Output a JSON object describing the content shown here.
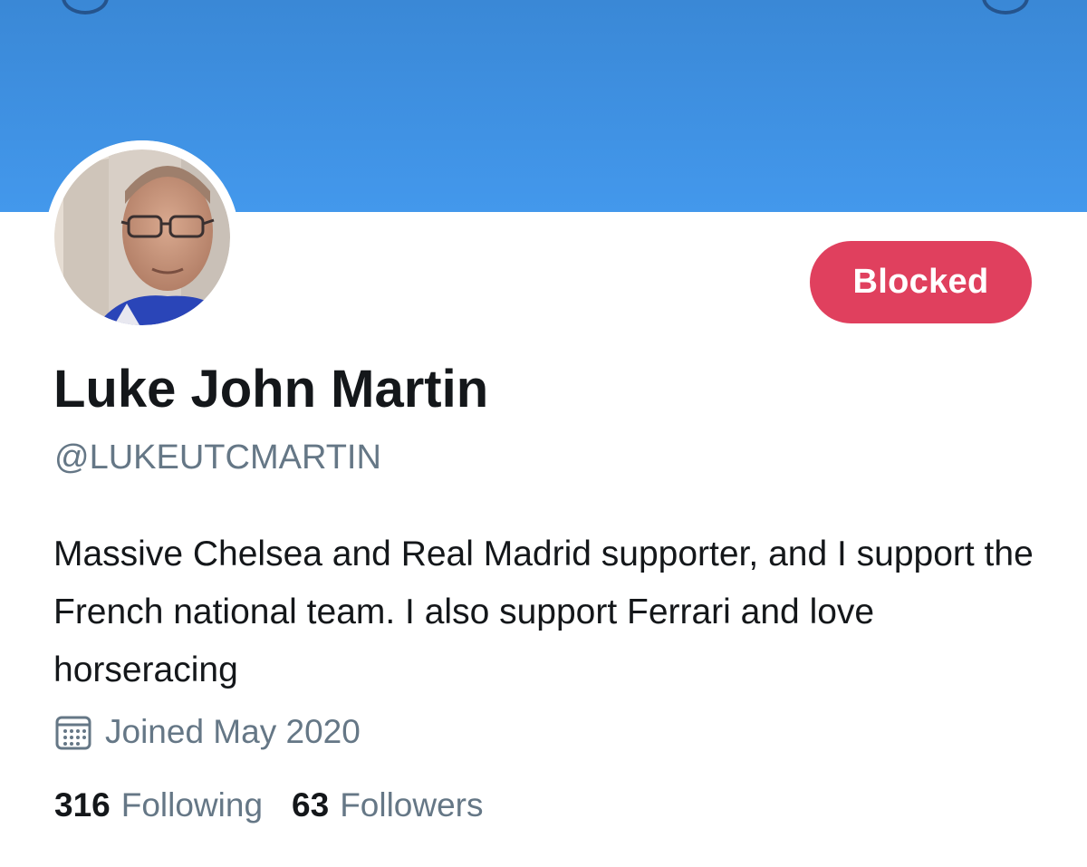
{
  "profile": {
    "display_name": "Luke John Martin",
    "handle": "@LUKEUTCMARTIN",
    "bio": "Massive Chelsea and Real Madrid supporter, and I support the French national team. I also support Ferrari and love horseracing",
    "joined": "Joined May 2020",
    "following_count": "316",
    "following_label": "Following",
    "followers_count": "63",
    "followers_label": "Followers"
  },
  "actions": {
    "blocked_label": "Blocked"
  },
  "icons": {
    "joined": "calendar-icon"
  },
  "colors": {
    "banner": "#4398ec",
    "blocked_button": "#e0405e",
    "primary_text": "#14171a",
    "secondary_text": "#657786"
  }
}
